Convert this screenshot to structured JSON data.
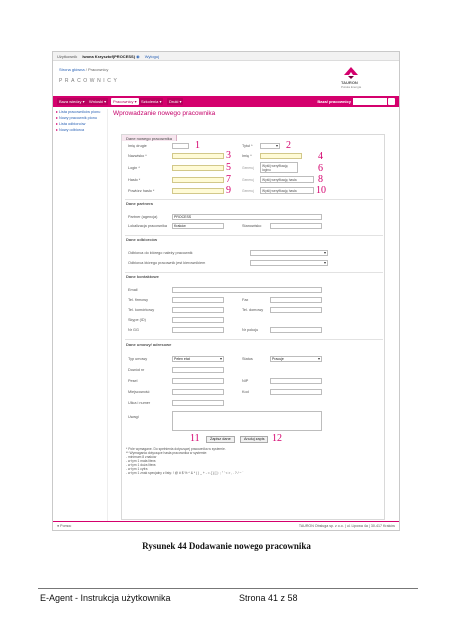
{
  "app": {
    "topbar": {
      "user_label": "Użytkownik",
      "user_name": "Iwona Krzysztof(PROCESS)",
      "link": "Wyloguj"
    },
    "breadcrumb": {
      "home": "Strona główna",
      "separator": "/",
      "current": "Pracownicy"
    },
    "module_title": "PRACOWNICY",
    "logo": {
      "name": "TAURON",
      "tagline": "Polska Energia"
    },
    "menu": {
      "items": [
        "Baza wiedzy ▾",
        "Wnioski ▾",
        "Pracownicy ▾",
        "Szkolenia ▾",
        "Druki ▾"
      ],
      "search_label": "Baza/ pracownicy",
      "search_placeholder": ""
    },
    "sidebar": {
      "items": [
        "Lista pracowników pionu",
        "Nowy pracownik pionu",
        "Lista odbiorców",
        "Nowy odbiorca"
      ]
    },
    "page_title": "Wprowadzanie nowego pracownika",
    "tab": "Dane nowego pracownika",
    "form": {
      "imie_drugie_label": "Imię drugie",
      "tytul_label": "Tytuł *",
      "nazwisko_label": "Nazwisko *",
      "imie_label": "Imię *",
      "login_label": "Login *",
      "haslo_label": "Hasło *",
      "powtorz_haslo_label": "Powtórz hasło *",
      "generate_label": "Generuj",
      "note_login": "Wyślij weryfikację loginu",
      "note_haslo": "Wyślij weryfikację hasła",
      "note_powtorz": "Wyślij weryfikację hasła",
      "section_partner": "Dane partnera",
      "partner_label": "Partner (agencja)",
      "partner_value": "PROCESS",
      "lokalizacja_label": "Lokalizacja pracownika",
      "lokalizacja_value": "Kraków",
      "stanowisko_label": "Stanowisko",
      "section_odbiorcow": "Dane odbiorców",
      "odbiorca1_label": "Odbiorca do którego należy pracownik",
      "odbiorca2_label": "Odbiorca którego pracownik jest kierownikiem",
      "section_kontaktowe": "Dane kontaktowe",
      "email_label": "Email",
      "tel_label": "Tel. firmowy",
      "fax_label": "Fax",
      "tel_kom_label": "Tel. komórkowy",
      "tel_dom_label": "Tel. domowy",
      "skype_label": "Skype (ID)",
      "gg_label": "Nr GG",
      "nr_pokoju_label": "Nr pokoju",
      "section_umowy": "Dane umowy/ adresowe",
      "typ_label": "Typ umowy",
      "typ_value": "Pełen etat",
      "status_label": "Status",
      "status_value": "Pracuje",
      "dowod_label": "Dowód nr",
      "pesel_label": "Pesel",
      "nip_label": "NIP",
      "miejscowosc_label": "Miejscowość",
      "kod_label": "Kod",
      "ulica_label": "Ulica i numer",
      "uwagi_label": "Uwagi",
      "save_button": "Zapisz dane",
      "cancel_button": "Anuluj zapis",
      "legend": [
        "* Pole wymagane. Do spełnienia dotyczącej pracownika w systemie.",
        "** Wymagania dotyczące hasła pracownika w systemie:",
        "   - minimum 8 znaków",
        "   - w tym 1 mała litera",
        "   - w tym 1 duża litera",
        "   - w tym 1 cyfra",
        "   - w tym 1 znak specjalny z listy: ! @ # $ % ^ & * ( ) _ + - = { } [ ] : ; \" ' < > , . ? / ~ `"
      ]
    },
    "footer": {
      "left": "Pomoc",
      "right": "TAURON Obsługa sp. z o.o. | ul. Lipowa 4a | 30-417 Kraków"
    }
  },
  "callouts": [
    "1",
    "2",
    "3",
    "4",
    "5",
    "6",
    "7",
    "8",
    "9",
    "10",
    "11",
    "12"
  ],
  "document": {
    "caption": "Rysunek 44 Dodawanie nowego pracownika",
    "footer_left": "E-Agent - Instrukcja użytkownika",
    "footer_right": "Strona 41 z 58"
  },
  "colors": {
    "accent": "#d4006d",
    "callout": "#d4006d",
    "required_fill": "#fffbd6"
  }
}
